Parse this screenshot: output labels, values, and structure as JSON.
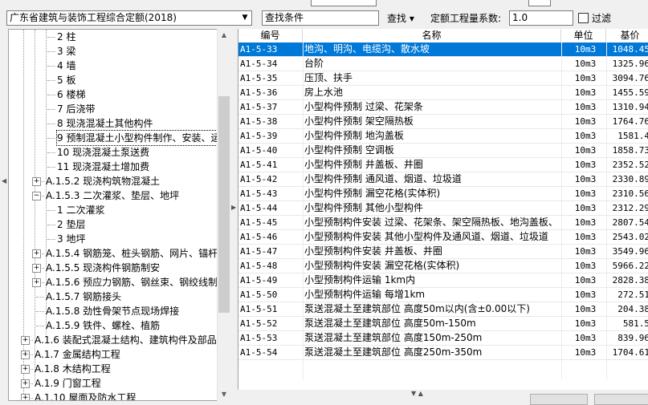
{
  "toolbar": {
    "quota_select": "广东省建筑与装饰工程综合定额(2018)",
    "search_placeholder": "查找条件",
    "find_label": "查找",
    "find_arrow": "▾",
    "coef_label": "定额工程量系数:",
    "coef_value": "1.0",
    "filter_label": "过滤"
  },
  "tree": {
    "items": [
      {
        "label": "2 柱"
      },
      {
        "label": "3 梁"
      },
      {
        "label": "4 墙"
      },
      {
        "label": "5 板"
      },
      {
        "label": "6 楼梯"
      },
      {
        "label": "7 后浇带"
      },
      {
        "label": "8 现浇混凝土其他构件"
      },
      {
        "label": "9 预制混凝土小型构件制作、安装、运"
      },
      {
        "label": "10 现浇混凝土泵送费"
      },
      {
        "label": "11 现浇混凝土增加费"
      },
      {
        "label": "A.1.5.2 现浇构筑物混凝土"
      },
      {
        "label": "A.1.5.3 二次灌浆、垫层、地坪"
      },
      {
        "label": "1 二次灌浆"
      },
      {
        "label": "2 垫层"
      },
      {
        "label": "3 地坪"
      },
      {
        "label": "A.1.5.4 钢筋笼、桩头钢筋、网片、锚杆"
      },
      {
        "label": "A.1.5.5 现浇构件钢筋制安"
      },
      {
        "label": "A.1.5.6 预应力钢筋、钢丝束、钢绞线制"
      },
      {
        "label": "A.1.5.7 钢筋接头"
      },
      {
        "label": "A.1.5.8 劲性骨架节点现场焊接"
      },
      {
        "label": "A.1.5.9 铁件、螺栓、植筋"
      },
      {
        "label": "A.1.6 装配式混凝土结构、建筑构件及部品"
      },
      {
        "label": "A.1.7 金属结构工程"
      },
      {
        "label": "A.1.8 木结构工程"
      },
      {
        "label": "A.1.9 门窗工程"
      },
      {
        "label": "A.1.10 屋面及防水工程"
      }
    ]
  },
  "grid": {
    "headers": {
      "code": "编号",
      "name": "名称",
      "unit": "单位",
      "price": "基价"
    },
    "rows": [
      {
        "code": "A1-5-33",
        "name": "地沟、明沟、电缆沟、散水坡",
        "unit": "10m3",
        "price": "1048.45"
      },
      {
        "code": "A1-5-34",
        "name": "台阶",
        "unit": "10m3",
        "price": "1325.96"
      },
      {
        "code": "A1-5-35",
        "name": "压顶、扶手",
        "unit": "10m3",
        "price": "3094.76"
      },
      {
        "code": "A1-5-36",
        "name": "房上水池",
        "unit": "10m3",
        "price": "1455.59"
      },
      {
        "code": "A1-5-37",
        "name": "小型构件预制 过梁、花架条",
        "unit": "10m3",
        "price": "1310.94"
      },
      {
        "code": "A1-5-38",
        "name": "小型构件预制 架空隔热板",
        "unit": "10m3",
        "price": "1764.76"
      },
      {
        "code": "A1-5-39",
        "name": "小型构件预制 地沟盖板",
        "unit": "10m3",
        "price": "1581.4"
      },
      {
        "code": "A1-5-40",
        "name": "小型构件预制 空调板",
        "unit": "10m3",
        "price": "1858.73"
      },
      {
        "code": "A1-5-41",
        "name": "小型构件预制 井盖板、井圈",
        "unit": "10m3",
        "price": "2352.52"
      },
      {
        "code": "A1-5-42",
        "name": "小型构件预制 通风道、烟道、垃圾道",
        "unit": "10m3",
        "price": "2330.89"
      },
      {
        "code": "A1-5-43",
        "name": "小型构件预制 漏空花格(实体积)",
        "unit": "10m3",
        "price": "2310.56"
      },
      {
        "code": "A1-5-44",
        "name": "小型构件预制 其他小型构件",
        "unit": "10m3",
        "price": "2312.29"
      },
      {
        "code": "A1-5-45",
        "name": "小型预制构件安装 过梁、花架条、架空隔热板、地沟盖板、",
        "unit": "10m3",
        "price": "2807.54"
      },
      {
        "code": "A1-5-46",
        "name": "小型预制构件安装 其他小型构件及通风道、烟道、垃圾道",
        "unit": "10m3",
        "price": "2543.02"
      },
      {
        "code": "A1-5-47",
        "name": "小型预制构件安装 井盖板、井圈",
        "unit": "10m3",
        "price": "3549.96"
      },
      {
        "code": "A1-5-48",
        "name": "小型预制构件安装 漏空花格(实体积)",
        "unit": "10m3",
        "price": "5966.22"
      },
      {
        "code": "A1-5-49",
        "name": "小型预制构件运输 1km内",
        "unit": "10m3",
        "price": "2828.38"
      },
      {
        "code": "A1-5-50",
        "name": "小型预制构件运输 每增1km",
        "unit": "10m3",
        "price": "272.51"
      },
      {
        "code": "A1-5-51",
        "name": "泵送混凝土至建筑部位 高度50m以内(含±0.00以下)",
        "unit": "10m3",
        "price": "204.38"
      },
      {
        "code": "A1-5-52",
        "name": "泵送混凝土至建筑部位 高度50m-150m",
        "unit": "10m3",
        "price": "581.5"
      },
      {
        "code": "A1-5-53",
        "name": "泵送混凝土至建筑部位 高度150m-250m",
        "unit": "10m3",
        "price": "839.96"
      },
      {
        "code": "A1-5-54",
        "name": "泵送混凝土至建筑部位 高度250m-350m",
        "unit": "10m3",
        "price": "1704.61"
      }
    ]
  },
  "colors": {
    "selection": "#0078d7"
  }
}
